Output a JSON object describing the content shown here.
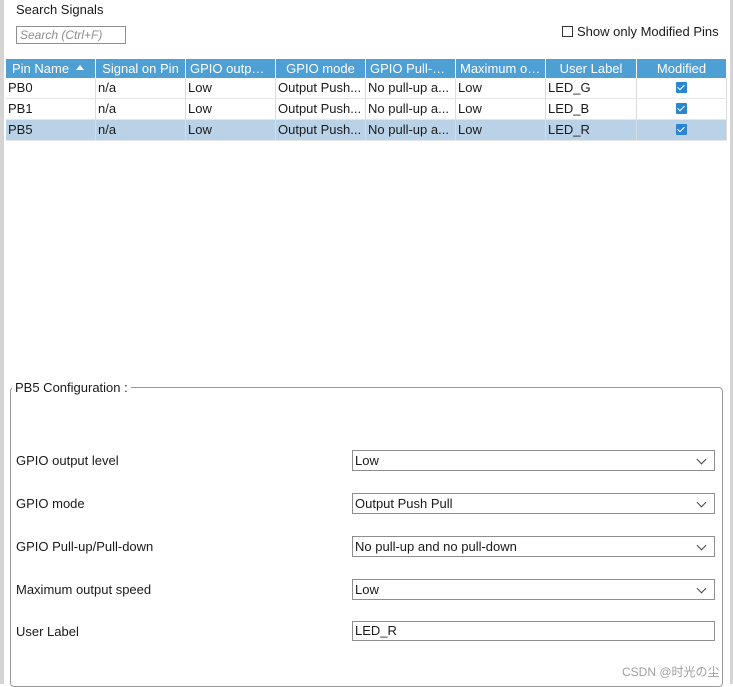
{
  "search": {
    "title": "Search Signals",
    "placeholder": "Search (Ctrl+F)"
  },
  "filter": {
    "label": "Show only Modified Pins",
    "checked": false
  },
  "table": {
    "columns": [
      "Pin Name",
      "Signal on Pin",
      "GPIO output ...",
      "GPIO mode",
      "GPIO Pull-up...",
      "Maximum ou...",
      "User Label",
      "Modified"
    ],
    "rows": [
      {
        "cells": [
          "PB0",
          "n/a",
          "Low",
          "Output Push...",
          "No pull-up a...",
          "Low",
          "LED_G"
        ],
        "modified": true,
        "selected": false
      },
      {
        "cells": [
          "PB1",
          "n/a",
          "Low",
          "Output Push...",
          "No pull-up a...",
          "Low",
          "LED_B"
        ],
        "modified": true,
        "selected": false
      },
      {
        "cells": [
          "PB5",
          "n/a",
          "Low",
          "Output Push...",
          "No pull-up a...",
          "Low",
          "LED_R"
        ],
        "modified": true,
        "selected": true
      }
    ]
  },
  "config": {
    "title": "PB5 Configuration :",
    "output_level": {
      "label": "GPIO output level",
      "value": "Low"
    },
    "mode": {
      "label": "GPIO mode",
      "value": "Output Push Pull"
    },
    "pull": {
      "label": "GPIO Pull-up/Pull-down",
      "value": "No pull-up and no pull-down"
    },
    "speed": {
      "label": "Maximum output speed",
      "value": "Low"
    },
    "user_label": {
      "label": "User Label",
      "value": "LED_R"
    }
  },
  "watermark": "CSDN @时光の尘",
  "colors": {
    "header": "#4e9fd4",
    "selected_row": "#bad2e8",
    "checkbox": "#2a86d4"
  }
}
